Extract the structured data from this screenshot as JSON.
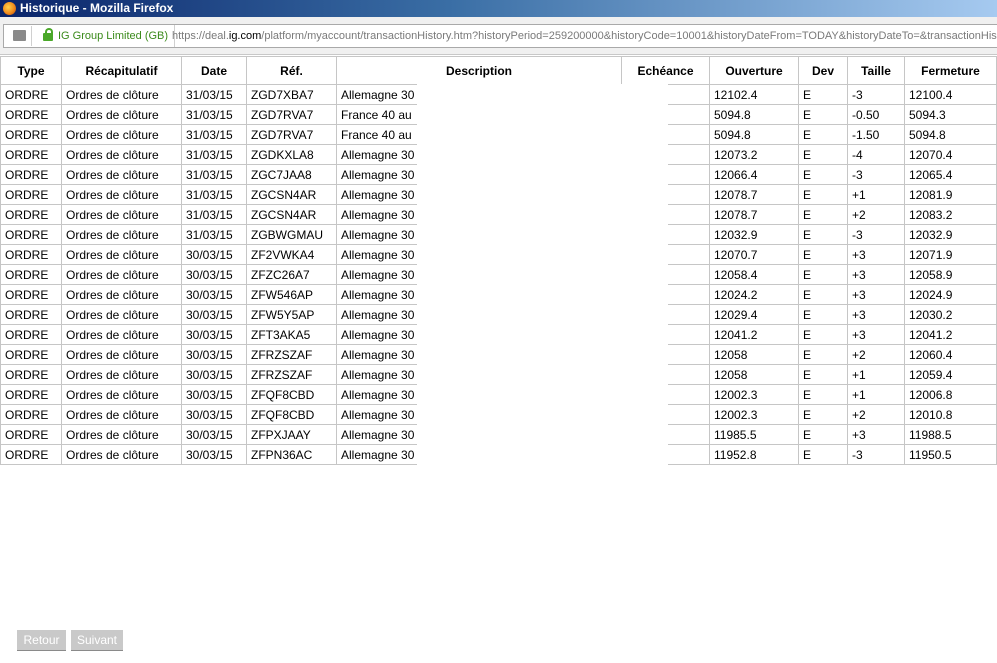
{
  "window": {
    "title": "Historique - Mozilla Firefox"
  },
  "urlbar": {
    "identity": "IG Group Limited (GB)",
    "url_prefix": "https://deal.",
    "url_host": "ig.com",
    "url_rest": "/platform/myaccount/transactionHistory.htm?historyPeriod=259200000&historyCode=10001&historyDateFrom=TODAY&historyDateTo=&transactionHis"
  },
  "table": {
    "headers": [
      "Type",
      "Récapitulatif",
      "Date",
      "Réf.",
      "Description",
      "Echéance",
      "Ouverture",
      "Dev",
      "Taille",
      "Fermeture"
    ],
    "rows": [
      [
        "ORDRE",
        "Ordres de clôture",
        "31/03/15",
        "ZGD7XBA7",
        "Allemagne 30",
        "",
        "12102.4",
        "E",
        "-3",
        "12100.4"
      ],
      [
        "ORDRE",
        "Ordres de clôture",
        "31/03/15",
        "ZGD7RVA7",
        "France 40 au",
        "",
        "5094.8",
        "E",
        "-0.50",
        "5094.3"
      ],
      [
        "ORDRE",
        "Ordres de clôture",
        "31/03/15",
        "ZGD7RVA7",
        "France 40 au",
        "",
        "5094.8",
        "E",
        "-1.50",
        "5094.8"
      ],
      [
        "ORDRE",
        "Ordres de clôture",
        "31/03/15",
        "ZGDKXLA8",
        "Allemagne 30",
        "",
        "12073.2",
        "E",
        "-4",
        "12070.4"
      ],
      [
        "ORDRE",
        "Ordres de clôture",
        "31/03/15",
        "ZGC7JAA8",
        "Allemagne 30",
        "",
        "12066.4",
        "E",
        "-3",
        "12065.4"
      ],
      [
        "ORDRE",
        "Ordres de clôture",
        "31/03/15",
        "ZGCSN4AR",
        "Allemagne 30",
        "",
        "12078.7",
        "E",
        "+1",
        "12081.9"
      ],
      [
        "ORDRE",
        "Ordres de clôture",
        "31/03/15",
        "ZGCSN4AR",
        "Allemagne 30",
        "",
        "12078.7",
        "E",
        "+2",
        "12083.2"
      ],
      [
        "ORDRE",
        "Ordres de clôture",
        "31/03/15",
        "ZGBWGMAU",
        "Allemagne 30",
        "",
        "12032.9",
        "E",
        "-3",
        "12032.9"
      ],
      [
        "ORDRE",
        "Ordres de clôture",
        "30/03/15",
        "ZF2VWKA4",
        "Allemagne 30",
        "",
        "12070.7",
        "E",
        "+3",
        "12071.9"
      ],
      [
        "ORDRE",
        "Ordres de clôture",
        "30/03/15",
        "ZFZC26A7",
        "Allemagne 30",
        "",
        "12058.4",
        "E",
        "+3",
        "12058.9"
      ],
      [
        "ORDRE",
        "Ordres de clôture",
        "30/03/15",
        "ZFW546AP",
        "Allemagne 30",
        "",
        "12024.2",
        "E",
        "+3",
        "12024.9"
      ],
      [
        "ORDRE",
        "Ordres de clôture",
        "30/03/15",
        "ZFW5Y5AP",
        "Allemagne 30",
        "",
        "12029.4",
        "E",
        "+3",
        "12030.2"
      ],
      [
        "ORDRE",
        "Ordres de clôture",
        "30/03/15",
        "ZFT3AKA5",
        "Allemagne 30",
        "",
        "12041.2",
        "E",
        "+3",
        "12041.2"
      ],
      [
        "ORDRE",
        "Ordres de clôture",
        "30/03/15",
        "ZFRZSZAF",
        "Allemagne 30",
        "",
        "12058",
        "E",
        "+2",
        "12060.4"
      ],
      [
        "ORDRE",
        "Ordres de clôture",
        "30/03/15",
        "ZFRZSZAF",
        "Allemagne 30",
        "",
        "12058",
        "E",
        "+1",
        "12059.4"
      ],
      [
        "ORDRE",
        "Ordres de clôture",
        "30/03/15",
        "ZFQF8CBD",
        "Allemagne 30",
        "",
        "12002.3",
        "E",
        "+1",
        "12006.8"
      ],
      [
        "ORDRE",
        "Ordres de clôture",
        "30/03/15",
        "ZFQF8CBD",
        "Allemagne 30",
        "",
        "12002.3",
        "E",
        "+2",
        "12010.8"
      ],
      [
        "ORDRE",
        "Ordres de clôture",
        "30/03/15",
        "ZFPXJAAY",
        "Allemagne 30",
        "",
        "11985.5",
        "E",
        "+3",
        "11988.5"
      ],
      [
        "ORDRE",
        "Ordres de clôture",
        "30/03/15",
        "ZFPN36AC",
        "Allemagne 30",
        "",
        "11952.8",
        "E",
        "-3",
        "11950.5"
      ]
    ]
  },
  "pagination": {
    "prev_label": "Retour",
    "next_label": "Suivant"
  }
}
